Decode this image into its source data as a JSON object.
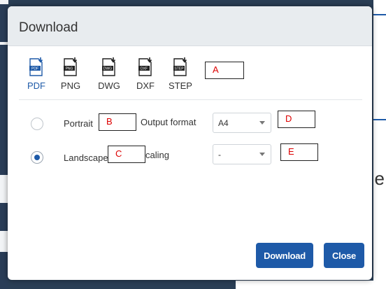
{
  "dialog": {
    "title": "Download"
  },
  "formats": [
    {
      "label": "PDF",
      "badge": "PDF",
      "active": true
    },
    {
      "label": "PNG",
      "badge": "PNG",
      "active": false
    },
    {
      "label": "DWG",
      "badge": "DWG",
      "active": false
    },
    {
      "label": "DXF",
      "badge": "DXF",
      "active": false
    },
    {
      "label": "STEP",
      "badge": "STEP",
      "active": false
    }
  ],
  "orientation": {
    "portrait_label": "Portrait",
    "landscape_label": "Landscape",
    "selected": "landscape"
  },
  "output_format": {
    "label": "Output format",
    "value": "A4"
  },
  "scaling": {
    "label": "caling",
    "value": "-"
  },
  "annotations": {
    "a": "A",
    "b": "B",
    "c": "C",
    "d": "D",
    "e": "E"
  },
  "buttons": {
    "download": "Download",
    "close": "Close"
  },
  "background": {
    "glyph": "e"
  },
  "colors": {
    "accent": "#1e5aa8",
    "annotation_text": "#dd0000",
    "header_bg": "#e8ecef"
  }
}
